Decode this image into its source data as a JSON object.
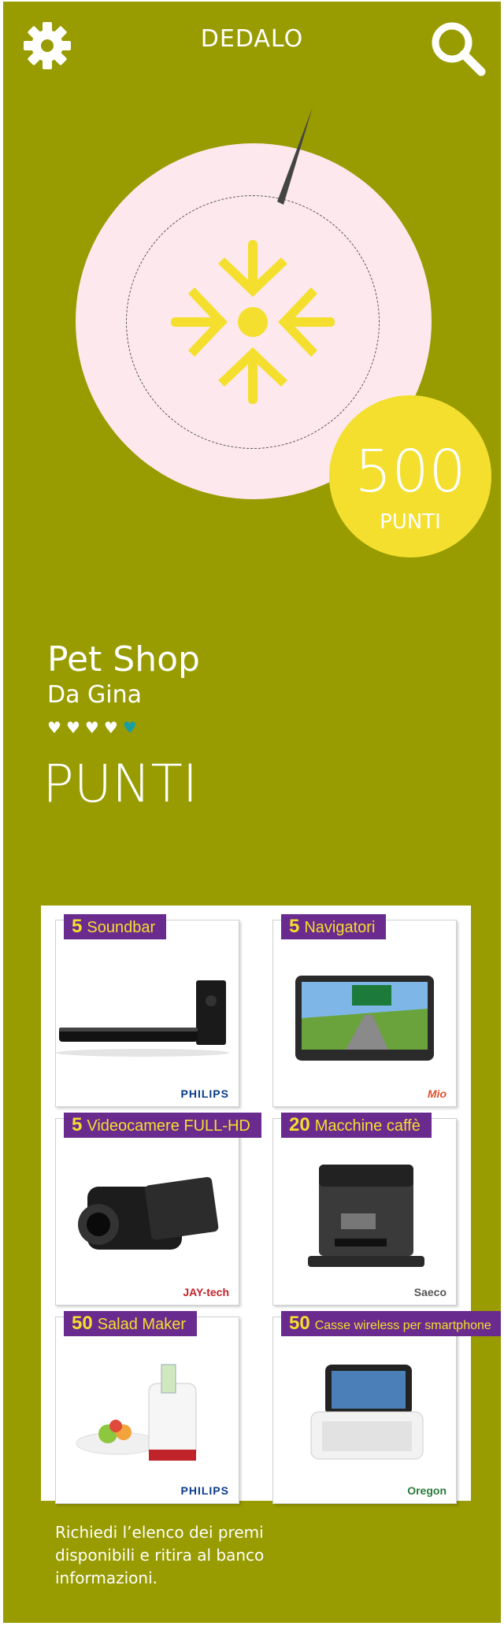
{
  "header": {
    "title": "DEDALO",
    "settings_icon": "gear-icon",
    "search_icon": "search-icon"
  },
  "colors": {
    "background": "#989c00",
    "dial": "#fde8ee",
    "accent": "#f4df2e",
    "label_purple": "#6a2b8e",
    "rating_active": "#1a9ea0"
  },
  "points": {
    "value": "500",
    "unit": "PUNTI"
  },
  "shop": {
    "name": "Pet Shop",
    "owner": "Da Gina",
    "rating": {
      "filled": 4,
      "max": 5
    }
  },
  "section": {
    "title": "PUNTI"
  },
  "prizes": [
    {
      "points": "5",
      "name": "Soundbar",
      "brand": "PHILIPS"
    },
    {
      "points": "5",
      "name": "Navigatori",
      "brand": "Mio"
    },
    {
      "points": "5",
      "name": "Videocamere FULL-HD",
      "brand": "JAY-tech"
    },
    {
      "points": "20",
      "name": "Macchine caffè",
      "brand": "Saeco"
    },
    {
      "points": "50",
      "name": "Salad Maker",
      "brand": "PHILIPS"
    },
    {
      "points": "50",
      "name": "Casse wireless per smartphone",
      "brand": "Oregon"
    }
  ],
  "footer": {
    "note": "Richiedi l’elenco dei premi disponibili e ritira al banco informazioni."
  }
}
